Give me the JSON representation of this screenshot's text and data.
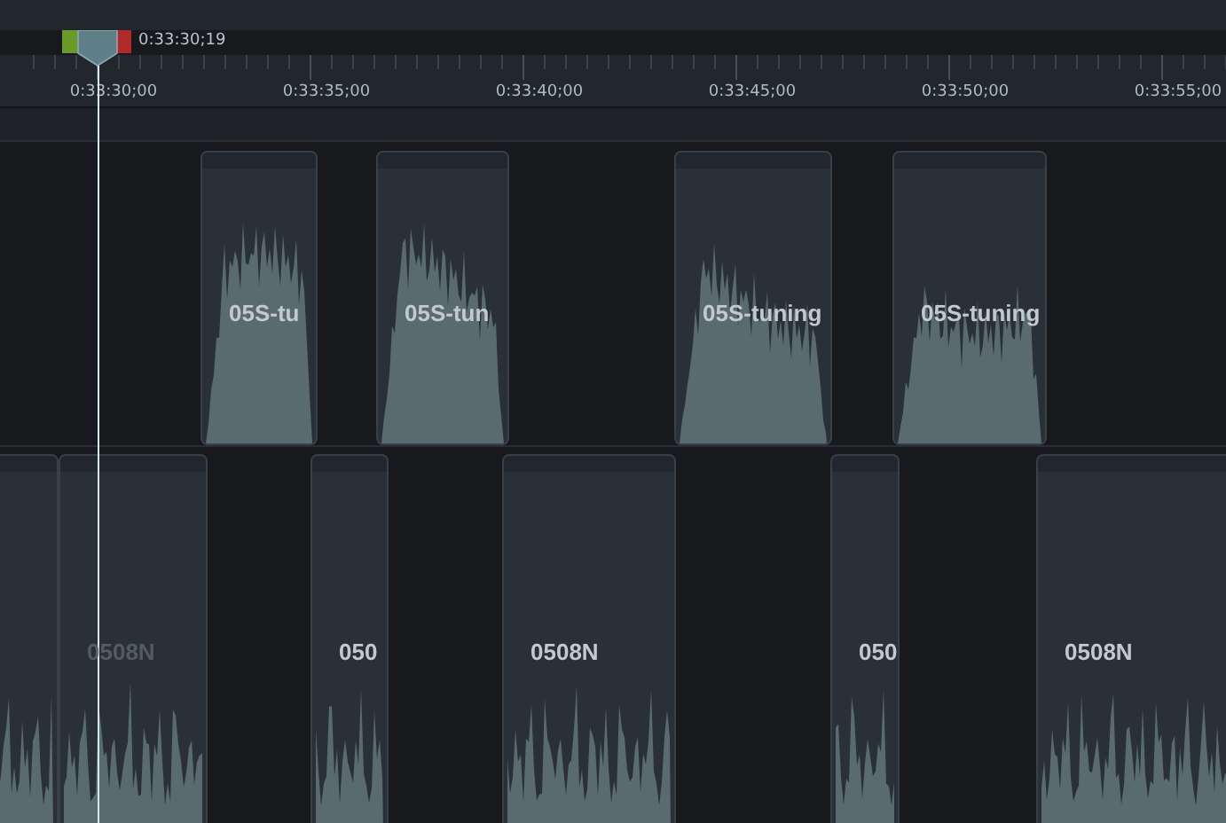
{
  "playhead": {
    "time": "0:33:30;19"
  },
  "ruler": {
    "labels": [
      "0:33:30;00",
      "0:33:35;00",
      "0:33:40;00",
      "0:33:45;00",
      "0:33:50;00",
      "0:33:55;00"
    ]
  },
  "tracks": [
    {
      "kind": "tone",
      "clips": [
        {
          "label": "05S-tu",
          "dimmed": false
        },
        {
          "label": "05S-tun",
          "dimmed": false
        },
        {
          "label": "05S-tuning",
          "dimmed": false
        },
        {
          "label": "05S-tuning",
          "dimmed": false
        }
      ]
    },
    {
      "kind": "speech",
      "leading_clip": true,
      "clips": [
        {
          "label": "0508N",
          "dimmed": true
        },
        {
          "label": "050",
          "dimmed": false
        },
        {
          "label": "0508N",
          "dimmed": false
        },
        {
          "label": "050",
          "dimmed": false
        },
        {
          "label": "0508N",
          "dimmed": false
        }
      ]
    }
  ]
}
